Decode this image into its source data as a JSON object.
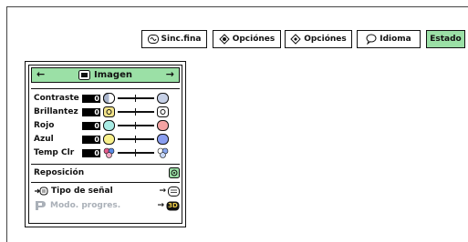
{
  "tabs": [
    {
      "label": "Sinc.fina",
      "icon": "sync-fine-icon"
    },
    {
      "label": "Opciónes",
      "icon": "options-icon"
    },
    {
      "label": "Opciónes",
      "icon": "options-icon"
    },
    {
      "label": "Idioma",
      "icon": "speech-bubble-icon"
    },
    {
      "label": "Estado",
      "icon": "",
      "active": true
    }
  ],
  "panel": {
    "title": "Imagen",
    "adjustments": [
      {
        "label": "Contraste",
        "value": "0",
        "icon": "contrast-icon",
        "fill": "#a8b4cc"
      },
      {
        "label": "Brillantez",
        "value": "0",
        "icon": "brightness-icon",
        "fill": "#f4e48a"
      },
      {
        "label": "Rojo",
        "value": "0",
        "icon": "red-icon",
        "fill": "#a8ebe4",
        "fill_right": "#f4a3a3"
      },
      {
        "label": "Azul",
        "value": "0",
        "icon": "blue-icon",
        "fill": "#f8f08a",
        "fill_right": "#8a9ef0"
      },
      {
        "label": "Temp Clr",
        "value": "0",
        "icon": "color-temp-icon",
        "fill": "#e45a8a"
      }
    ],
    "reset_label": "Reposición",
    "signal_type_label": "Tipo de señal",
    "progressive_label": "Modo. progres.",
    "progressive_badge": "3D"
  },
  "colors": {
    "accent": "#9be0a6",
    "disabled": "#aab0b8"
  }
}
